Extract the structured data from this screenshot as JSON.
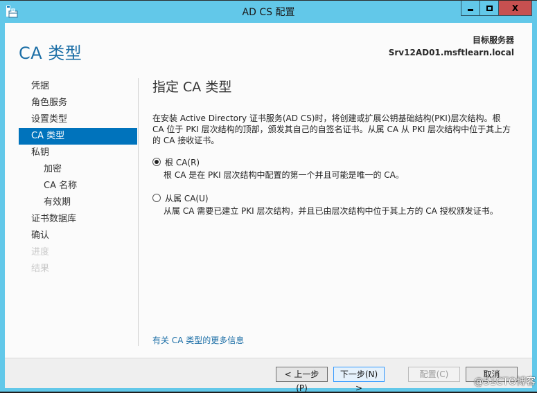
{
  "window": {
    "title": "AD CS 配置",
    "icon": "server-briefcase-icon",
    "controls": {
      "minimize": "minimize",
      "maximize": "maximize",
      "close": "X"
    }
  },
  "header": {
    "page_title": "CA 类型",
    "target_server_label": "目标服务器",
    "target_server_name": "Srv12AD01.msftlearn.local"
  },
  "nav": {
    "items": [
      {
        "label": "凭据",
        "state": "normal",
        "level": 0
      },
      {
        "label": "角色服务",
        "state": "normal",
        "level": 0
      },
      {
        "label": "设置类型",
        "state": "normal",
        "level": 0
      },
      {
        "label": "CA 类型",
        "state": "active",
        "level": 0
      },
      {
        "label": "私钥",
        "state": "normal",
        "level": 0
      },
      {
        "label": "加密",
        "state": "normal",
        "level": 1
      },
      {
        "label": "CA 名称",
        "state": "normal",
        "level": 1
      },
      {
        "label": "有效期",
        "state": "normal",
        "level": 1
      },
      {
        "label": "证书数据库",
        "state": "normal",
        "level": 0
      },
      {
        "label": "确认",
        "state": "normal",
        "level": 0
      },
      {
        "label": "进度",
        "state": "disabled",
        "level": 0
      },
      {
        "label": "结果",
        "state": "disabled",
        "level": 0
      }
    ]
  },
  "content": {
    "title": "指定 CA 类型",
    "description": "在安装 Active Directory 证书服务(AD CS)时，将创建或扩展公钥基础结构(PKI)层次结构。根 CA 位于 PKI 层次结构的顶部，颁发其自己的自签名证书。从属 CA 从 PKI 层次结构中位于其上方的 CA 接收证书。",
    "options": [
      {
        "label": "根 CA(R)",
        "selected": true,
        "description": "根 CA 是在 PKI 层次结构中配置的第一个并且可能是唯一的 CA。"
      },
      {
        "label": "从属 CA(U)",
        "selected": false,
        "description": "从属 CA 需要已建立 PKI 层次结构，并且已由层次结构中位于其上方的 CA 授权颁发证书。"
      }
    ],
    "more_info_link": "有关 CA 类型的更多信息"
  },
  "footer": {
    "prev_label": "< 上一步(P)",
    "next_label": "下一步(N) >",
    "configure_label": "配置(C)",
    "cancel_label": "取消"
  },
  "watermark": "@51CTO博客",
  "colors": {
    "frame": "#62c8e9",
    "accent": "#0073bc",
    "close_button": "#c75050",
    "link": "#1b6ea6"
  }
}
